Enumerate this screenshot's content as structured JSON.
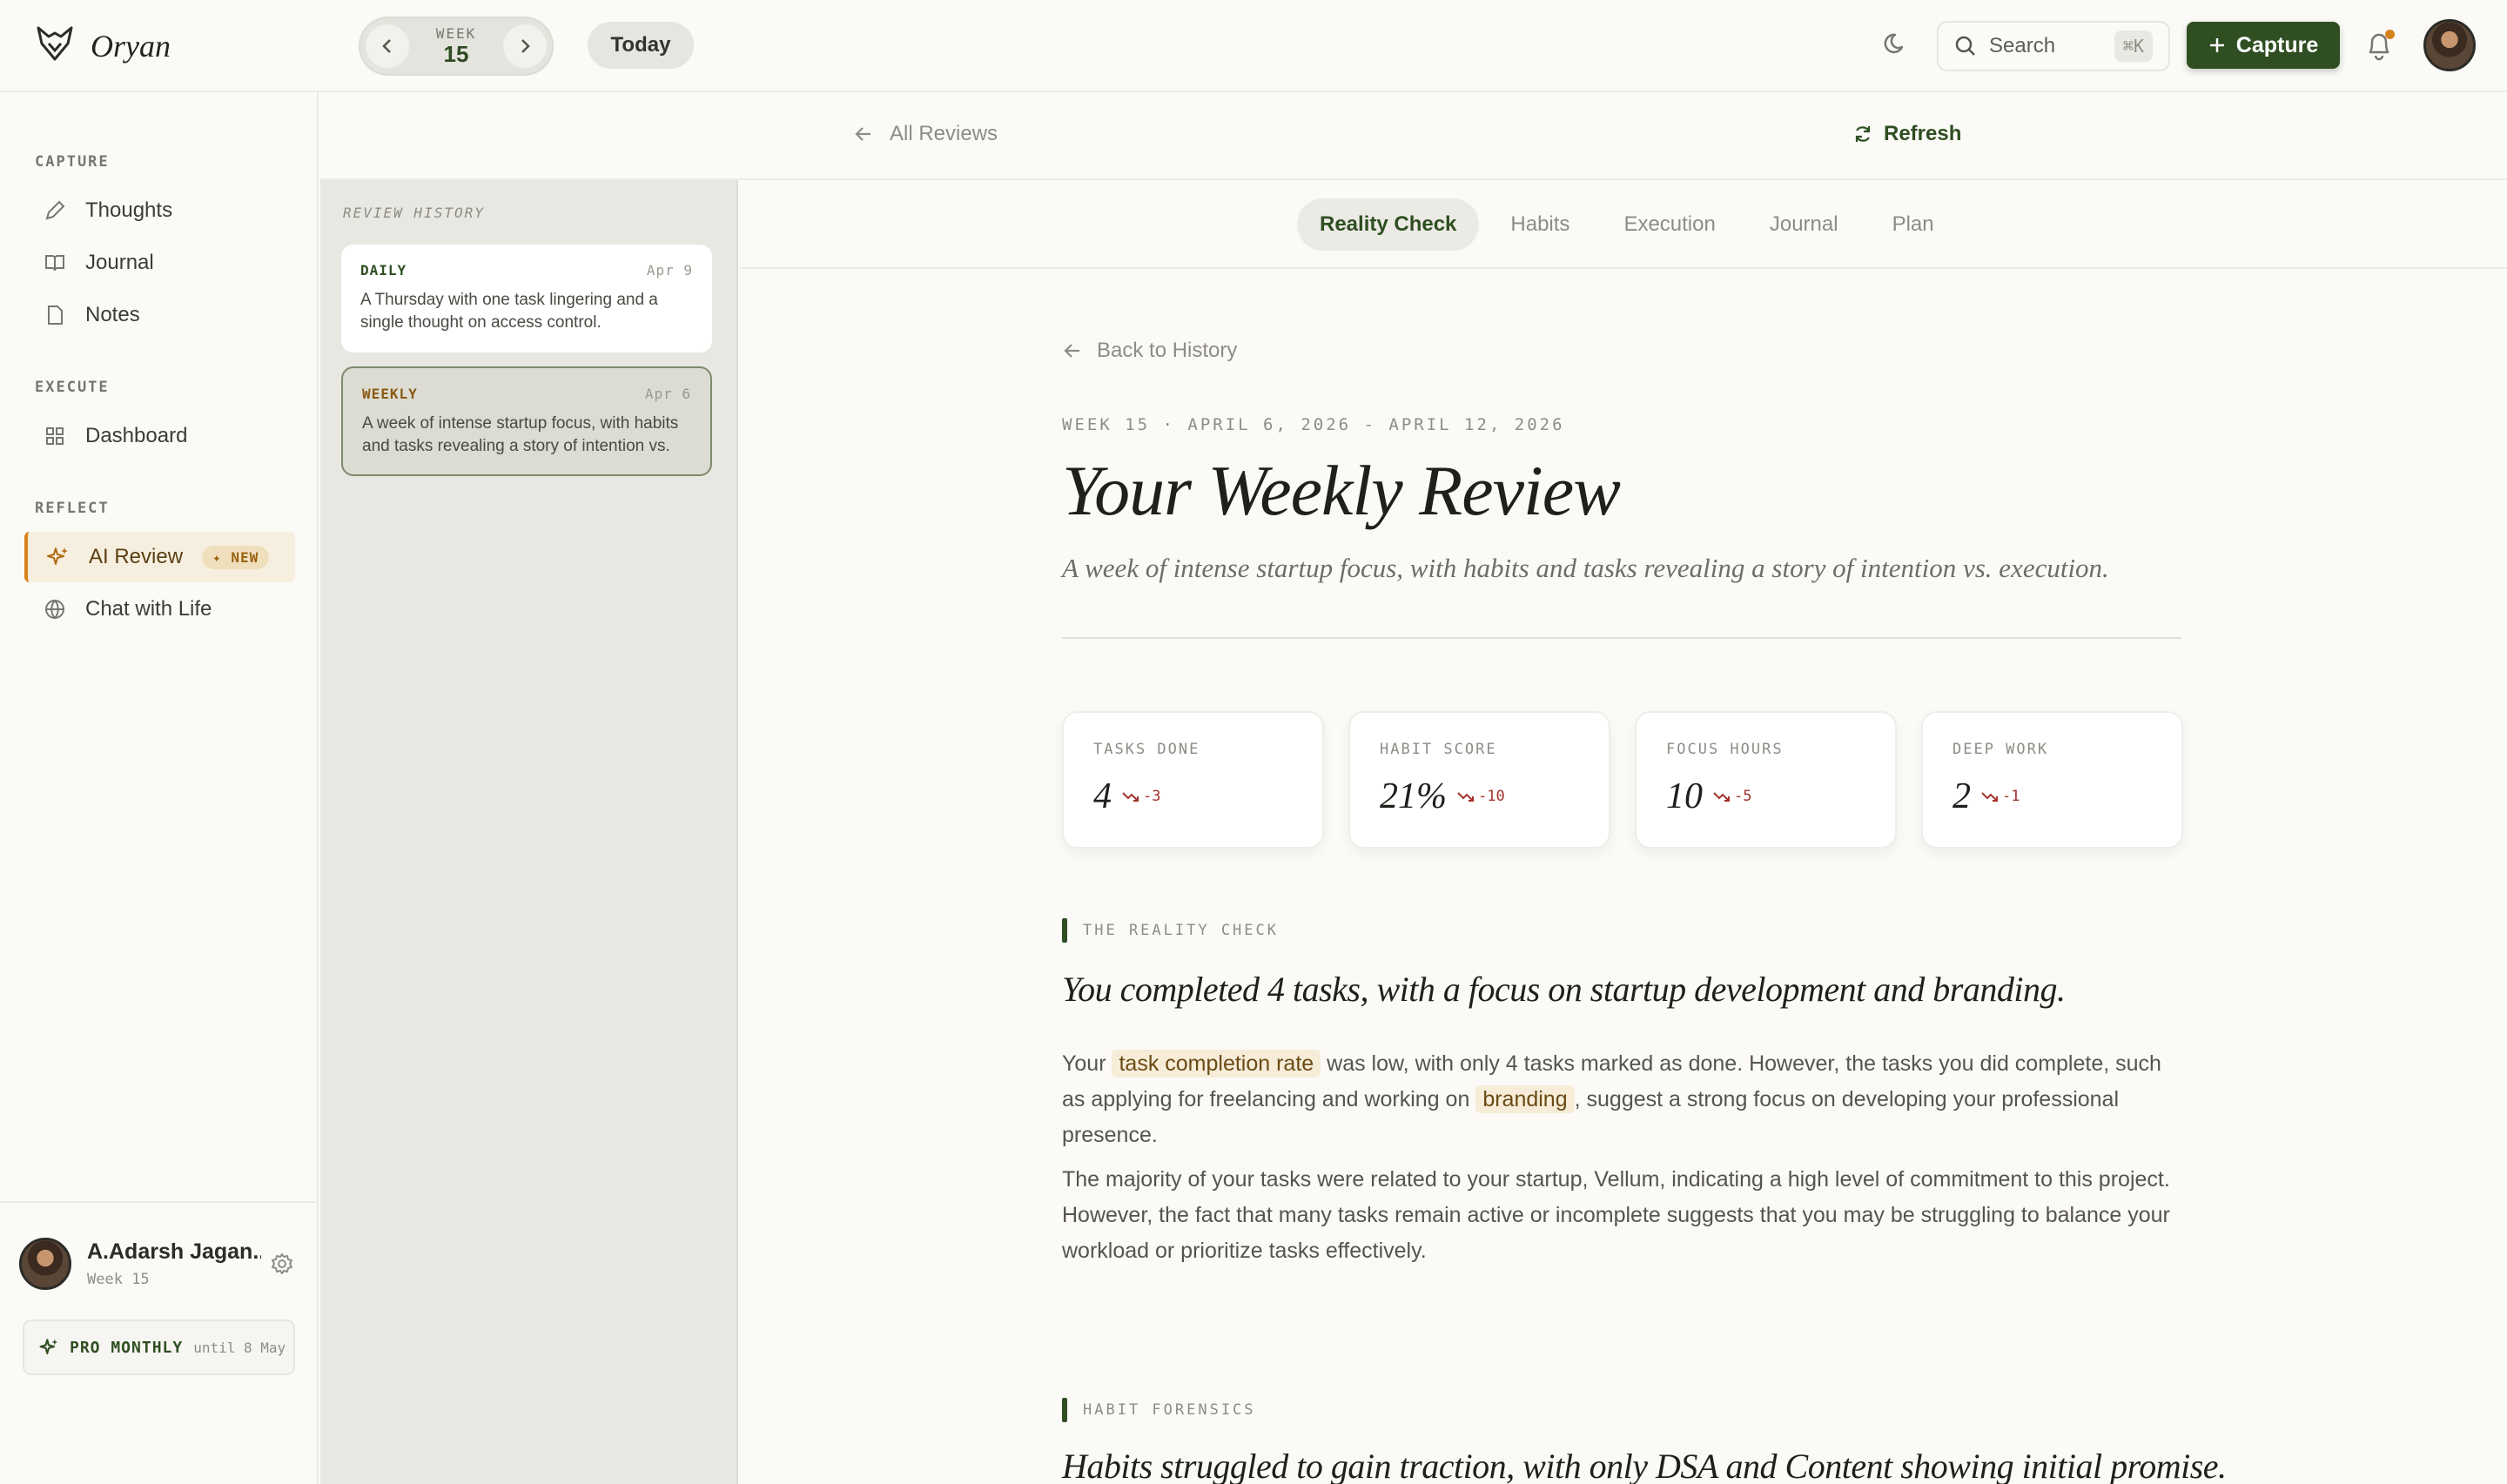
{
  "brand": {
    "name": "Oryan"
  },
  "week_nav": {
    "label": "WEEK",
    "number": "15",
    "today_label": "Today"
  },
  "search": {
    "placeholder": "Search",
    "shortcut": "⌘K"
  },
  "capture": {
    "label": "Capture"
  },
  "sidebar": {
    "sections": [
      {
        "title": "CAPTURE",
        "items": [
          "Thoughts",
          "Journal",
          "Notes"
        ]
      },
      {
        "title": "EXECUTE",
        "items": [
          "Dashboard"
        ]
      },
      {
        "title": "REFLECT",
        "items": [
          "AI Review",
          "Chat with Life"
        ]
      }
    ],
    "new_badge": "✦ NEW",
    "user": {
      "name": "A.Adarsh Jagan...",
      "week": "Week 15"
    },
    "plan": {
      "label": "PRO MONTHLY",
      "until": "until 8 May"
    }
  },
  "subheader": {
    "all_reviews": "All Reviews",
    "refresh": "Refresh"
  },
  "history": {
    "title": "REVIEW HISTORY",
    "cards": [
      {
        "type": "DAILY",
        "date": "Apr 9",
        "text": "A Thursday with one task lingering and a single thought on access control."
      },
      {
        "type": "WEEKLY",
        "date": "Apr 6",
        "text": "A week of intense startup focus, with habits and tasks revealing a story of intention vs. execution."
      }
    ]
  },
  "tabs": [
    "Reality Check",
    "Habits",
    "Execution",
    "Journal",
    "Plan"
  ],
  "review": {
    "back_label": "Back to History",
    "week_range": "WEEK 15 · APRIL 6, 2026 - APRIL 12, 2026",
    "title": "Your Weekly Review",
    "subtitle": "A week of intense startup focus, with habits and tasks revealing a story of intention vs. execution.",
    "stats": [
      {
        "label": "TASKS DONE",
        "value": "4",
        "delta": "-3"
      },
      {
        "label": "HABIT SCORE",
        "value": "21%",
        "delta": "-10"
      },
      {
        "label": "FOCUS HOURS",
        "value": "10",
        "delta": "-5"
      },
      {
        "label": "DEEP WORK",
        "value": "2",
        "delta": "-1"
      }
    ],
    "reality": {
      "label": "THE REALITY CHECK",
      "title": "You completed 4 tasks, with a focus on startup development and branding.",
      "p1_a": "Your",
      "p1_hl1": "task completion rate",
      "p1_b": "was low, with only 4 tasks marked as done. However, the tasks you did complete, such as applying for freelancing and working on",
      "p1_hl2": "branding",
      "p1_c": ", suggest a strong focus on developing your professional presence.",
      "p2": "The majority of your tasks were related to your startup, Vellum, indicating a high level of commitment to this project. However, the fact that many tasks remain active or incomplete suggests that you may be struggling to balance your workload or prioritize tasks effectively."
    },
    "habits": {
      "label": "HABIT FORENSICS",
      "title": "Habits struggled to gain traction, with only DSA and Content showing initial promise."
    }
  }
}
